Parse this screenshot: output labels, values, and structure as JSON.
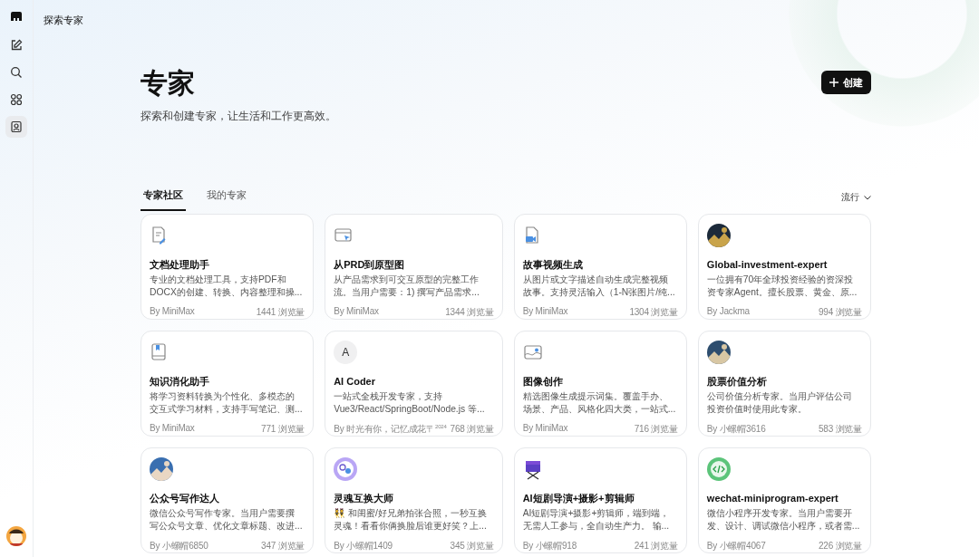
{
  "sidebar": {
    "items": [
      {
        "selected": false
      },
      {
        "selected": false
      },
      {
        "selected": false
      },
      {
        "selected": true
      }
    ]
  },
  "top_bar": {
    "title": "探索专家"
  },
  "header": {
    "title": "专家",
    "subtitle": "探索和创建专家，让生活和工作更高效。",
    "create_button": "创建"
  },
  "tabs": [
    {
      "label": "专家社区",
      "selected": true
    },
    {
      "label": "我的专家",
      "selected": false
    }
  ],
  "sort": {
    "label": "流行"
  },
  "cards": [
    {
      "title": "文档处理助手",
      "description": [
        "专业的文档处理工具，支持PDF和",
        "DOCX的创建、转换、内容整理和操..."
      ],
      "author": "By MiniMax",
      "views": "1441 浏览量"
    },
    {
      "title": "从PRD到原型图",
      "description": [
        "从产品需求到可交互原型的完整工作",
        "流。当用户需要：1) 撰写产品需求..."
      ],
      "author": "By MiniMax",
      "views": "1344 浏览量"
    },
    {
      "title": "故事视频生成",
      "description": [
        "从图片或文字描述自动生成完整视频",
        "故事。支持灵活输入（1-N张图片/纯..."
      ],
      "author": "By MiniMax",
      "views": "1304 浏览量"
    },
    {
      "kind": "picture",
      "title": "Global-investment-expert",
      "description": [
        "一位拥有70年全球投资经验的资深投",
        "资专家Agent。擅长股票、黄金、原..."
      ],
      "author": "By Jackma",
      "views": "994 浏览量"
    },
    {
      "title": "知识消化助手",
      "description": [
        "将学习资料转换为个性化、多模态的",
        "交互式学习材料，支持手写笔记、测..."
      ],
      "author": "By MiniMax",
      "views": "771 浏览量"
    },
    {
      "letter": "A",
      "title": "AI Coder",
      "description": [
        "一站式全栈开发专家，支持",
        "Vue3/React/SpringBoot/Node.js 等..."
      ],
      "author": "By 时光有你，记忆成花〒$^{2024}$",
      "views": "768 浏览量"
    },
    {
      "title": "图像创作",
      "description": [
        "精选图像生成提示词集。覆盖手办、",
        "场景、产品、风格化四大类，一站式..."
      ],
      "author": "By MiniMax",
      "views": "716 浏览量"
    },
    {
      "kind": "picture",
      "title": "股票价值分析",
      "description": [
        "公司价值分析专家。当用户评估公司",
        "投资价值时使用此专家。"
      ],
      "author": "By 小螺帽3616",
      "views": "583 浏览量"
    },
    {
      "kind": "picture",
      "title": "公众号写作达人",
      "description": [
        "微信公众号写作专家。当用户需要撰",
        "写公众号文章、优化文章标题、改进..."
      ],
      "author": "By 小螺帽6850",
      "views": "347 浏览量"
    },
    {
      "title": "灵魂互换大师",
      "description": [
        "👯 和闺蜜/好兄弟拍张合照，一秒互换",
        "灵魂！看看你俩换脸后谁更好笑？上..."
      ],
      "author": "By 小螺帽1409",
      "views": "345 浏览量"
    },
    {
      "title": "AI短剧导演+摄影+剪辑师",
      "description": [
        "AI短剧导演+摄影+剪辑师，端到端，",
        "无需人工参与，全自动生产力。 输..."
      ],
      "author": "By 小螺帽918",
      "views": "241 浏览量"
    },
    {
      "title": "wechat-miniprogram-expert",
      "description": [
        "微信小程序开发专家。当用户需要开",
        "发、设计、调试微信小程序，或者需..."
      ],
      "author": "By 小螺帽4067",
      "views": "226 浏览量"
    }
  ]
}
